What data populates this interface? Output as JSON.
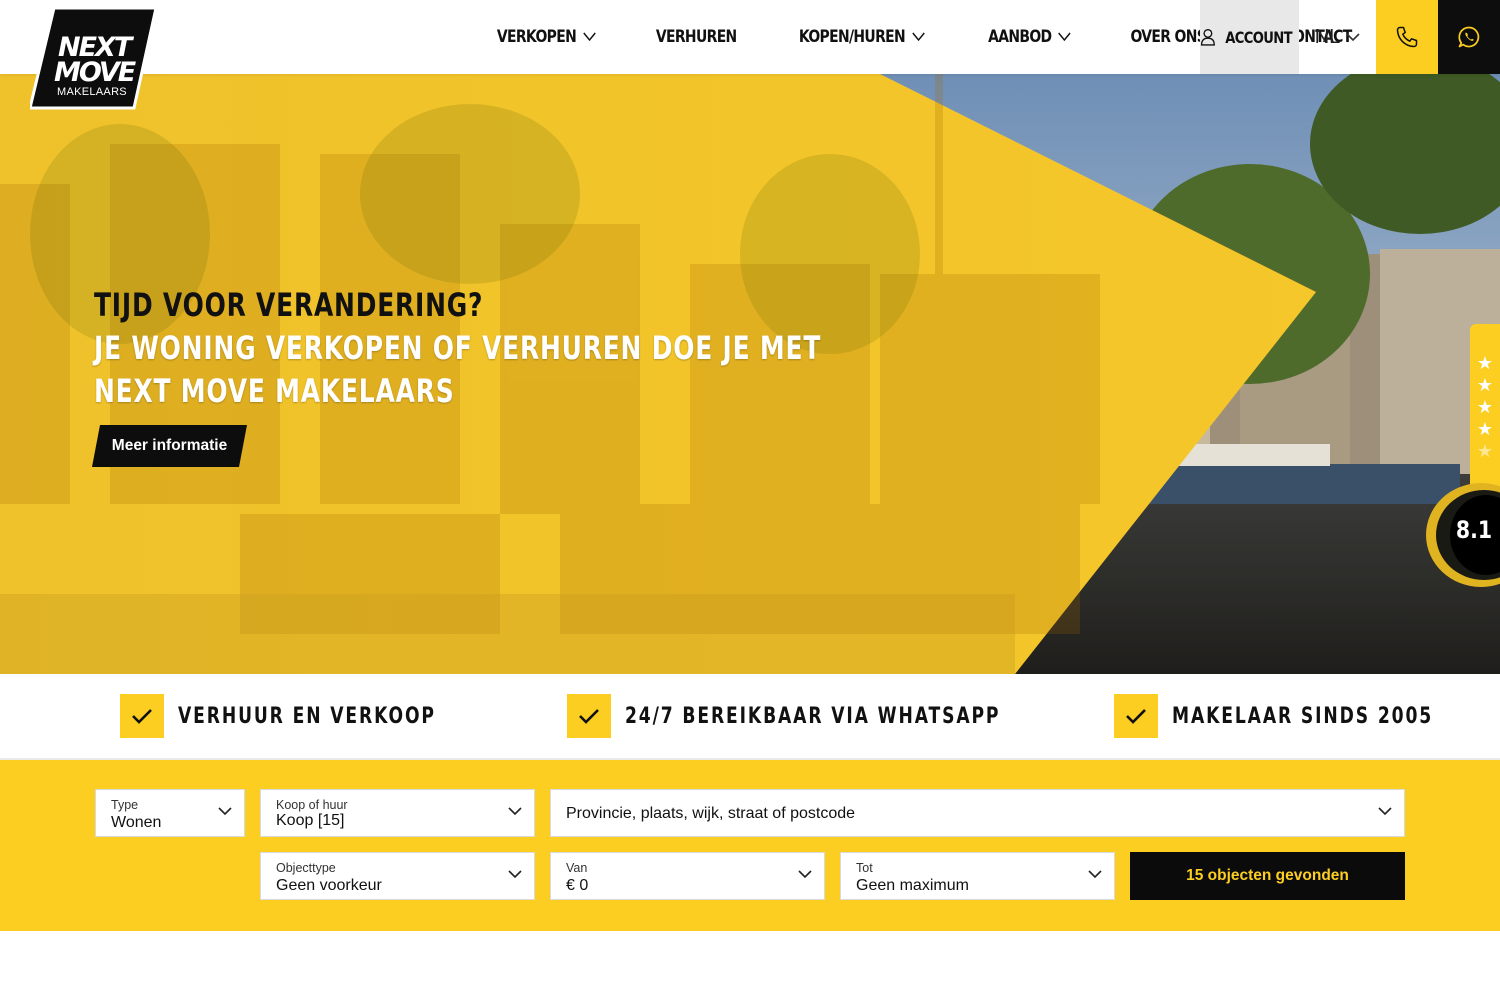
{
  "brand": {
    "logo_text_1": "NEXT",
    "logo_text_2": "MOVE",
    "logo_text_3": "MAKELAARS",
    "accent_color": "#fcce22",
    "dark_color": "#0d0d0d"
  },
  "nav": {
    "items": [
      {
        "label": "VERKOPEN",
        "has_dropdown": true
      },
      {
        "label": "VERHUREN",
        "has_dropdown": false
      },
      {
        "label": "KOPEN/HUREN",
        "has_dropdown": true
      },
      {
        "label": "AANBOD",
        "has_dropdown": true
      },
      {
        "label": "OVER ONS",
        "has_dropdown": true
      },
      {
        "label": "CONTACT",
        "has_dropdown": false
      }
    ],
    "account_label": "ACCOUNT",
    "language": "NL",
    "phone_icon": "phone-icon",
    "whatsapp_icon": "whatsapp-icon"
  },
  "hero": {
    "line1": "TIJD VOOR VERANDERING?",
    "line2": "JE WONING VERKOPEN OF VERHUREN DOE JE MET",
    "line3": "NEXT MOVE MAKELAARS",
    "cta_label": "Meer informatie"
  },
  "rating": {
    "score": "8.1",
    "stars_total": 5,
    "stars_filled": 4
  },
  "usps": [
    {
      "label": "VERHUUR EN VERKOOP"
    },
    {
      "label": "24/7 BEREIKBAAR VIA WHATSAPP"
    },
    {
      "label": "MAKELAAR SINDS 2005"
    }
  ],
  "search": {
    "type": {
      "label": "Type",
      "value": "Wonen"
    },
    "koop_huur": {
      "label": "Koop of huur",
      "value": "Koop [15]"
    },
    "location": {
      "value": "Provincie, plaats, wijk, straat of postcode"
    },
    "objecttype": {
      "label": "Objecttype",
      "value": "Geen voorkeur"
    },
    "van": {
      "label": "Van",
      "value": "€ 0"
    },
    "tot": {
      "label": "Tot",
      "value": "Geen maximum"
    },
    "submit_label": "15 objecten gevonden"
  }
}
